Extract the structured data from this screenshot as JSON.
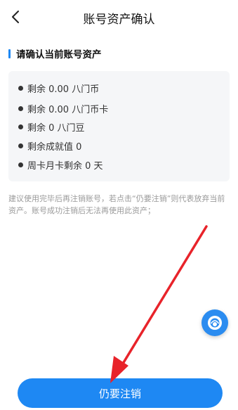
{
  "header": {
    "title": "账号资产确认",
    "back_icon": "chevron-left-icon"
  },
  "section": {
    "title": "请确认当前账号资产"
  },
  "assets": [
    {
      "label": "剩余 0.00 八门币"
    },
    {
      "label": "剩余 0.00 八门币卡"
    },
    {
      "label": "剩余 0 八门豆"
    },
    {
      "label": "剩余成就值 0"
    },
    {
      "label": "周卡月卡剩余 0 天"
    }
  ],
  "note": "建议使用完毕后再注销账号，若点击“仍要注销”则代表放弃当前资产。账号成功注销后无法再使用此资产；",
  "float_button": {
    "icon": "customer-service-icon"
  },
  "main_button": {
    "label": "仍要注销"
  },
  "colors": {
    "accent": "#1e88f3",
    "card_bg": "#f5f6f8",
    "annotation_arrow": "#e8232a"
  }
}
